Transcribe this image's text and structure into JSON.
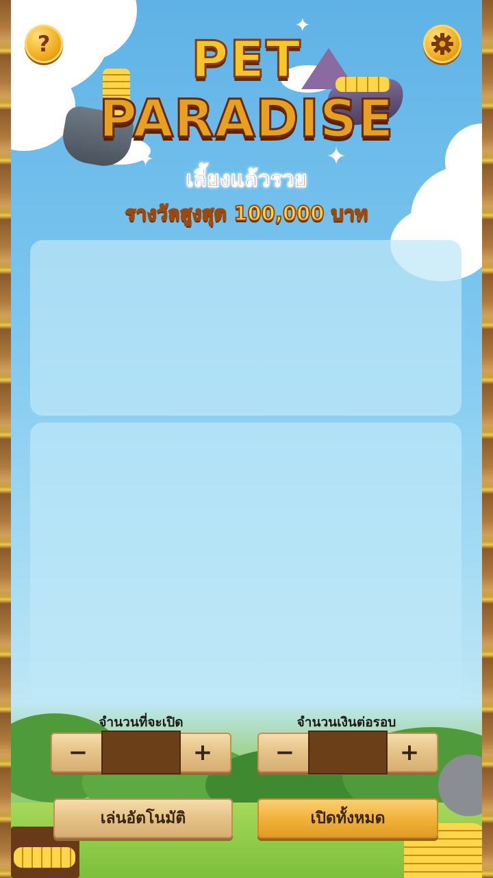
{
  "header": {
    "help_icon": "question-icon",
    "settings_icon": "gear-icon",
    "title_line1": "PET",
    "title_line2": "PARADISE",
    "subtitle": "เลี้ยงแล้วรวย",
    "prize": "รางวัลสูงสุด 100,000 บาท"
  },
  "controls": {
    "open_count": {
      "label": "จำนวนที่จะเปิด",
      "minus": "−",
      "plus": "+",
      "value": ""
    },
    "bet_per_round": {
      "label": "จำนวนเงินต่อรอบ",
      "minus": "−",
      "plus": "+",
      "value": ""
    },
    "auto_play_label": "เล่นอัตโนมัติ",
    "open_all_label": "เปิดทั้งหมด"
  },
  "colors": {
    "title_gold": "#f7c62a",
    "title_outline": "#8a3a10",
    "plank": "#e6c48a",
    "value_box": "#6b3f18",
    "open_all_button": "#f2b23a"
  }
}
